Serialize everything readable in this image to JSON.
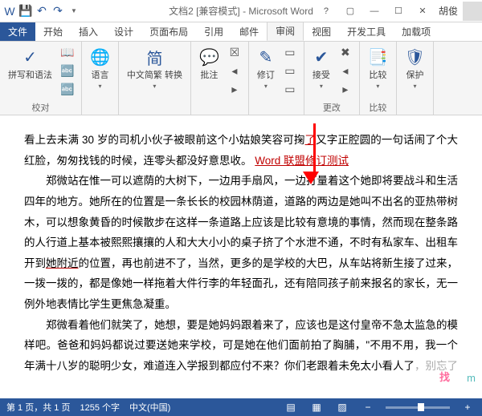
{
  "titlebar": {
    "title": "文档2 [兼容模式] - Microsoft Word",
    "user": "胡俊"
  },
  "tabs": {
    "file": "文件",
    "items": [
      "开始",
      "插入",
      "设计",
      "页面布局",
      "引用",
      "邮件",
      "审阅",
      "视图",
      "开发工具",
      "加载项"
    ],
    "active_index": 6
  },
  "ribbon": {
    "g0": {
      "btn": "字",
      "label": "拼写和语法",
      "group": "校对"
    },
    "g1": {
      "btn": "语言"
    },
    "g2": {
      "btn": "中文简繁\n转换"
    },
    "g3": {
      "btn": "批注"
    },
    "g4": {
      "btn": "修订"
    },
    "g5": {
      "btn": "接受",
      "group": "更改"
    },
    "g6": {
      "btn": "比较",
      "group": "比较"
    },
    "g7": {
      "btn": "保护"
    }
  },
  "document": {
    "p1a": "看上去未满 30 岁的司机小伙子被眼前这个小姑娘笑容可掬",
    "p1_ins": "了",
    "p1b": "又字正腔圆的一句话闹了个大红脸，匆匆找钱的时候，连零头都没好意思收。",
    "link": "Word 联盟修订测试",
    "p2": "郑微站在惟一可以遮荫的大树下，一边用手扇风，一边打量着这个她即将要战斗和生活四年的地方。她所在的位置是一条长长的校园林荫道，道路的两边是她叫不出名的亚热带树木，可以想象黄昏的时候散步在这样一条道路上应该是比较有意境的事情，然而现在整条路的人行道上基本被熙熙攘攘的人和大大小小的桌子挤了个水泄不通，不时有私家车、出租车开到",
    "p2_nearby": "她附近",
    "p2b": "的位置，再也前进不了，当然，更多的是学校的大巴，从车站将新生接了过来，一拨一拨的，都是像她一样拖着大件行李的年轻面孔，还有陪同孩子前来报名的家长，无一例外地表情比学生更焦急凝重。",
    "p3": "郑微看着他们就笑了，她想，要是她妈妈跟着来了，应该也是这付皇帝不急太监急的模样吧。爸爸和妈妈都说过要送她来学校，可是她在他们面前拍了胸脯，\"不用不用，我一个年满十八岁的聪明少女，难道连入学报到都应付不来？你们老跟着未免太小看人了",
    "p3_tail": "，别忘了"
  },
  "overlay": {
    "red": "找",
    "teal": "m"
  },
  "status": {
    "page": "第 1 页，共 1 页",
    "words": "1255 个字",
    "lang": "中文(中国)"
  }
}
